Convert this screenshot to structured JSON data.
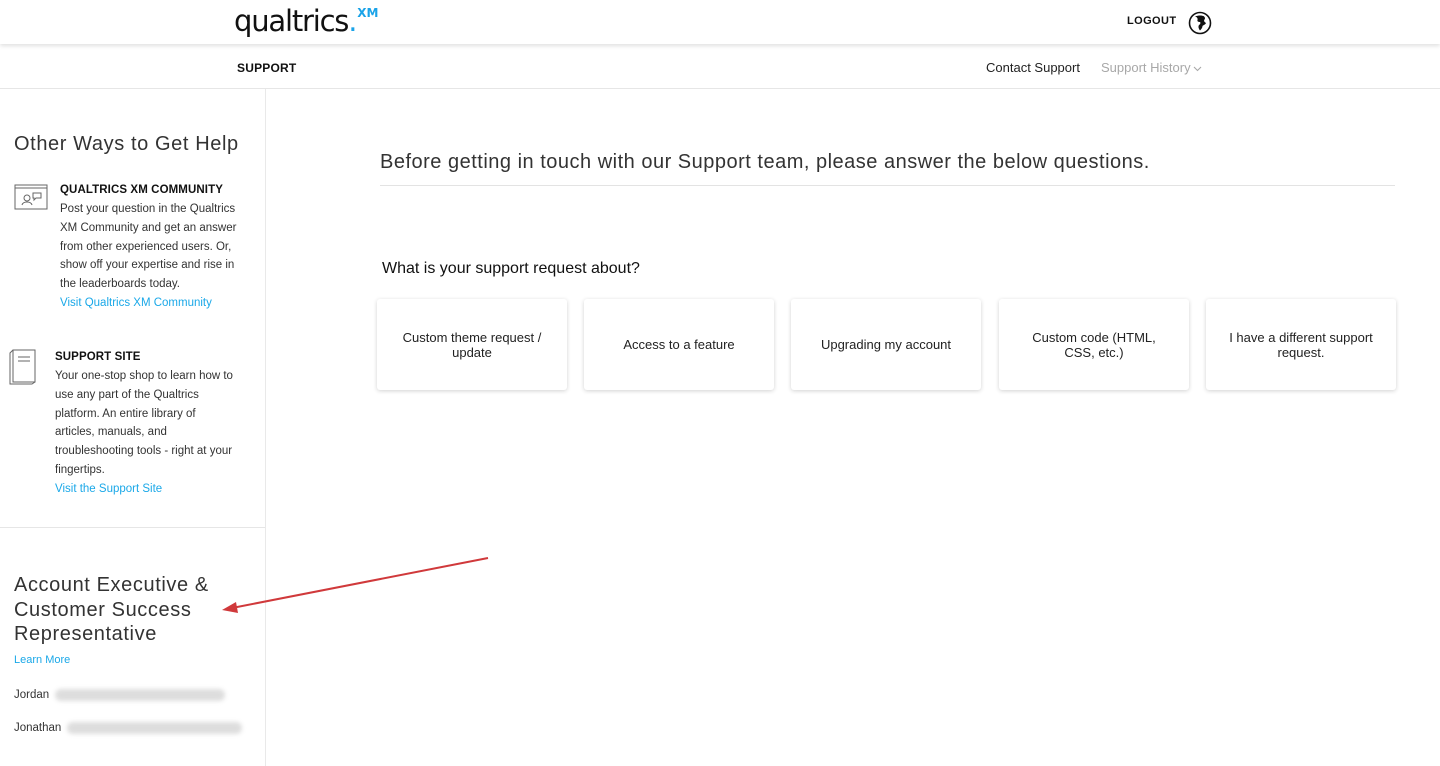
{
  "header": {
    "logo_text": "qualtrics",
    "logo_dot": ".",
    "logo_superscript": "XM",
    "logout_label": "LOGOUT",
    "globe_icon": "globe-icon"
  },
  "subnav": {
    "section_label": "SUPPORT",
    "contact_support": "Contact Support",
    "support_history": "Support History"
  },
  "sidebar": {
    "heading": "Other Ways to Get Help",
    "items": [
      {
        "icon": "community-icon",
        "title": "QUALTRICS XM COMMUNITY",
        "lines": [
          "Post your question in the Qualtrics",
          "XM Community and get an answer",
          "from other experienced users. Or,",
          "show off your expertise and rise in",
          "the leaderboards today."
        ],
        "link": "Visit Qualtrics XM Community"
      },
      {
        "icon": "book-icon",
        "title": "SUPPORT SITE",
        "lines": [
          "Your one-stop shop to learn how to",
          "use any part of the Qualtrics",
          "platform. An entire library of",
          "articles, manuals, and",
          "troubleshooting tools - right at your",
          "fingertips."
        ],
        "link": "Visit the Support Site"
      }
    ],
    "account_heading_lines": [
      "Account Executive &",
      "Customer Success",
      "Representative"
    ],
    "learn_more": "Learn More",
    "reps": [
      {
        "name": "Jordan"
      },
      {
        "name": "Jonathan"
      }
    ]
  },
  "main": {
    "intro": "Before getting in touch with our Support team, please answer the below questions.",
    "question": "What is your support request about?",
    "options": [
      "Custom theme request / update",
      "Access to a feature",
      "Upgrading my account",
      "Custom code (HTML, CSS, etc.)",
      "I have a different support request."
    ]
  },
  "annotation": {
    "arrow_color": "#d0393b"
  },
  "colors": {
    "accent": "#1aa8e8"
  }
}
